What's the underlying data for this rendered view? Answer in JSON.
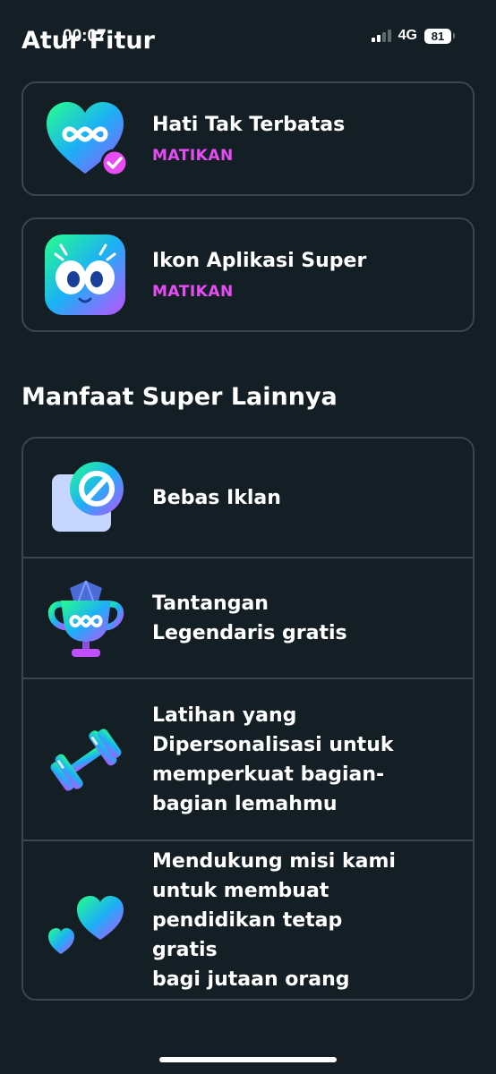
{
  "status_bar": {
    "time": "00:07",
    "network": "4G",
    "battery": "81"
  },
  "features": {
    "title": "Atur Fitur",
    "items": [
      {
        "name": "Hati Tak Terbatas",
        "action": "MATIKAN",
        "icon": "infinity-heart-icon"
      },
      {
        "name": "Ikon Aplikasi Super",
        "action": "MATIKAN",
        "icon": "super-owl-app-icon"
      }
    ]
  },
  "benefits": {
    "title": "Manfaat Super Lainnya",
    "items": [
      {
        "text": "Bebas Iklan",
        "icon": "no-ads-icon"
      },
      {
        "text": "Tantangan\nLegendaris gratis",
        "icon": "trophy-icon"
      },
      {
        "text": "Latihan yang\nDipersonalisasi untuk\nmemperkuat bagian-\nbagian lemahmu",
        "icon": "dumbbell-icon"
      },
      {
        "text": "Mendukung misi kami\nuntuk membuat\npendidikan tetap gratis\nbagi jutaan orang",
        "icon": "hearts-icon"
      }
    ]
  },
  "colors": {
    "background": "#131f24",
    "border": "#37464f",
    "accent": "#e84cf5"
  }
}
